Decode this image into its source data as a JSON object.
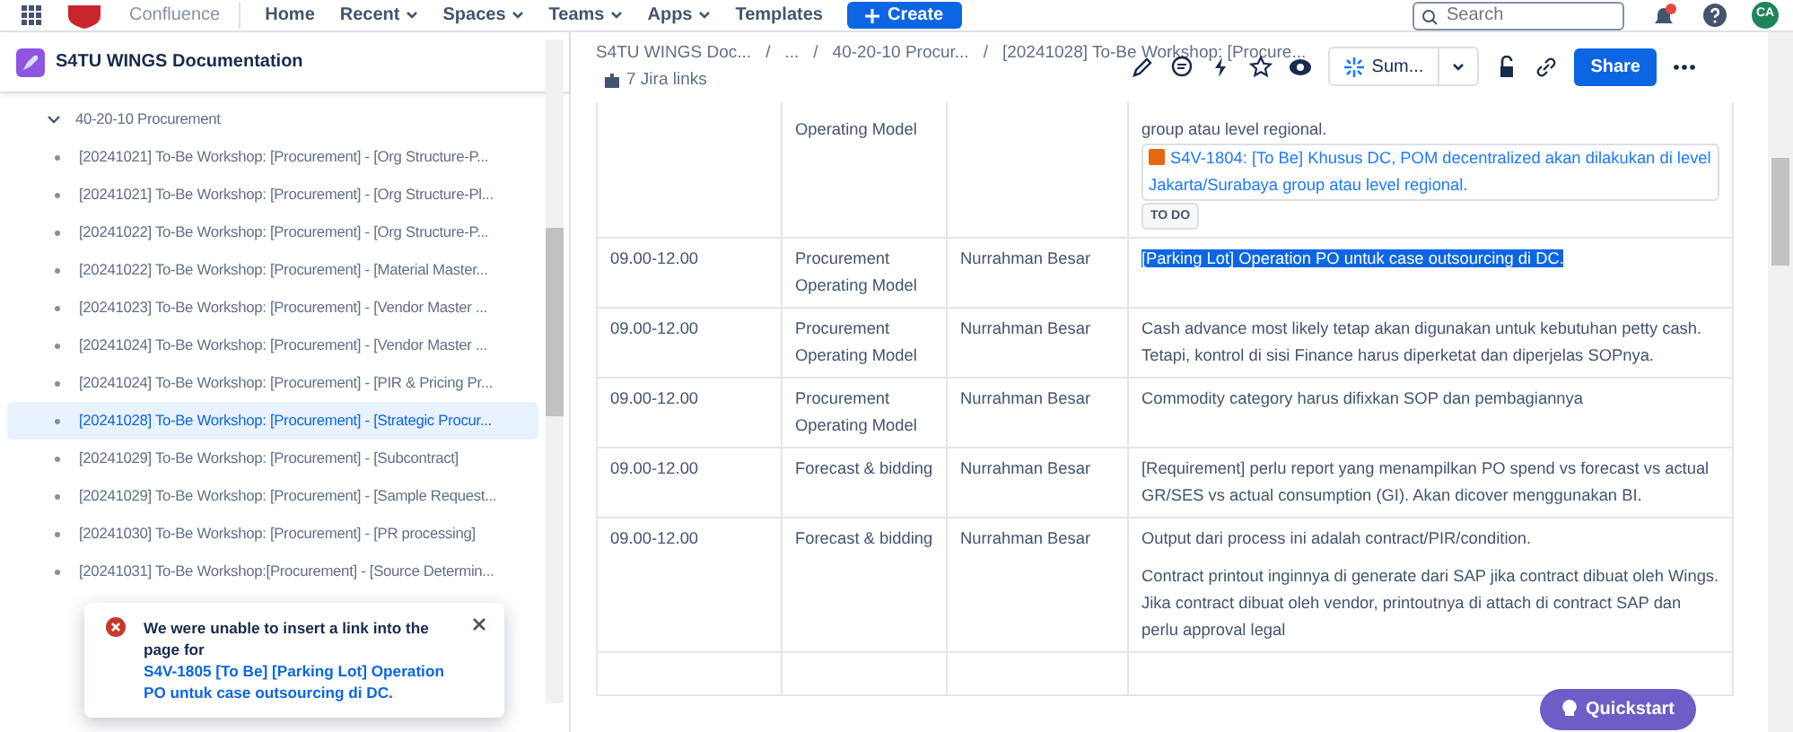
{
  "top_nav": {
    "product": "Confluence",
    "items": [
      {
        "label": "Home",
        "menu": false
      },
      {
        "label": "Recent",
        "menu": true
      },
      {
        "label": "Spaces",
        "menu": true
      },
      {
        "label": "Teams",
        "menu": true
      },
      {
        "label": "Apps",
        "menu": true
      },
      {
        "label": "Templates",
        "menu": false
      }
    ],
    "create": "Create",
    "search": {
      "placeholder": "Search"
    },
    "avatar": "CA"
  },
  "sidebar": {
    "space_title": "S4TU WINGS Documentation",
    "tree": [
      {
        "label": "40-20-10 Procurement",
        "expanded": true,
        "children": [
          {
            "label": "[20241021] To-Be Workshop: [Procurement] - [Org Structure-P...",
            "selected": false
          },
          {
            "label": "[20241021] To-Be Workshop: [Procurement] - [Org Structure-Pl...",
            "selected": false
          },
          {
            "label": "[20241022] To-Be Workshop: [Procurement] - [Org Structure-P...",
            "selected": false
          },
          {
            "label": "[20241022] To-Be Workshop: [Procurement] - [Material Master...",
            "selected": false
          },
          {
            "label": "[20241023] To-Be Workshop: [Procurement] - [Vendor Master ...",
            "selected": false
          },
          {
            "label": "[20241024] To-Be Workshop: [Procurement] - [Vendor Master ...",
            "selected": false
          },
          {
            "label": "[20241024] To-Be Workshop: [Procurement] - [PIR & Pricing Pr...",
            "selected": false
          },
          {
            "label": "[20241028] To-Be Workshop: [Procurement] - [Strategic Procur...",
            "selected": true
          },
          {
            "label": "[20241029] To-Be Workshop: [Procurement] - [Subcontract]",
            "selected": false
          },
          {
            "label": "[20241029] To-Be Workshop: [Procurement] - [Sample Request...",
            "selected": false
          },
          {
            "label": "[20241030] To-Be Workshop: [Procurement] - [PR processing]",
            "selected": false
          },
          {
            "label": "[20241031] To-Be Workshop:[Procurement] - [Source Determin...",
            "selected": false
          }
        ]
      }
    ]
  },
  "breadcrumb": [
    {
      "label": "S4TU WINGS Doc..."
    },
    {
      "separator": "/",
      "label": "..."
    },
    {
      "separator": "/",
      "label": "40-20-10 Procur..."
    },
    {
      "separator": "/",
      "label": "[20241028] To-Be Workshop: [Procure..."
    }
  ],
  "jira_links": "7 Jira links",
  "toolbar": {
    "summarize": "Sum...",
    "share": "Share"
  },
  "table": {
    "rows": [
      {
        "time": "",
        "area": "Operating Model",
        "person": "",
        "highlighted": false,
        "paragraphs": [
          {
            "lines": [
              "group atau level regional."
            ],
            "jira": {
              "key": "S4V-1804: [To Be] Khusus DC, POM decentralized akan dilakukan di level Jakarta/Surabaya group atau level regional.",
              "status": "TO DO"
            }
          }
        ]
      },
      {
        "time": "09.00-12.00",
        "area": "Procurement Operating Model",
        "person": "Nurrahman Besar",
        "highlighted": true,
        "paragraphs": [
          {
            "lines": [
              "[Parking Lot] Operation PO untuk case outsourcing di DC."
            ]
          }
        ]
      },
      {
        "time": "09.00-12.00",
        "area": "Procurement Operating Model",
        "person": "Nurrahman Besar",
        "highlighted": false,
        "paragraphs": [
          {
            "lines": [
              "Cash advance most likely tetap akan digunakan untuk kebutuhan petty cash. Tetapi, kontrol di sisi Finance harus diperketat dan diperjelas SOPnya."
            ]
          }
        ]
      },
      {
        "time": "09.00-12.00",
        "area": "Procurement Operating Model",
        "person": "Nurrahman Besar",
        "highlighted": false,
        "paragraphs": [
          {
            "lines": [
              "Commodity category harus difixkan SOP dan pembagiannya"
            ]
          }
        ]
      },
      {
        "time": "09.00-12.00",
        "area": "Forecast & bidding",
        "person": "Nurrahman Besar",
        "highlighted": false,
        "paragraphs": [
          {
            "lines": [
              "[Requirement] perlu report yang menampilkan PO spend vs forecast vs actual GR/SES vs actual consumption (GI). Akan dicover menggunakan BI."
            ]
          }
        ]
      },
      {
        "time": "09.00-12.00",
        "area": "Forecast & bidding",
        "person": "Nurrahman Besar",
        "highlighted": false,
        "paragraphs": [
          {
            "lines": [
              "Output dari process ini adalah contract/PIR/condition."
            ]
          },
          {
            "lines": [
              "Contract printout inginnya di generate dari SAP jika contract dibuat oleh Wings.",
              "Jika contract dibuat oleh vendor, printoutnya di attach di contract SAP dan perlu approval legal"
            ]
          }
        ]
      }
    ]
  },
  "toast": {
    "message": "We were unable to insert a link into the page for",
    "link": "S4V-1805 [To Be] [Parking Lot] Operation PO untuk case outsourcing di DC."
  },
  "quickstart": "Quickstart"
}
